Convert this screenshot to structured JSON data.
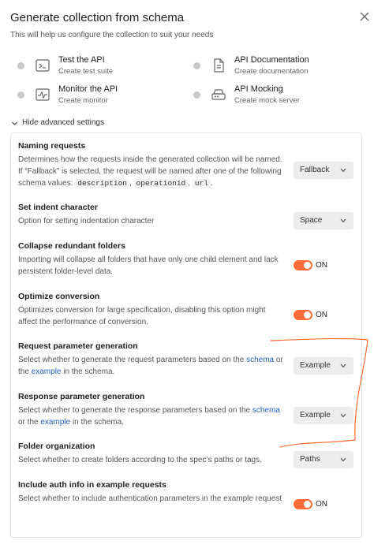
{
  "dialog": {
    "title": "Generate collection from schema",
    "subtitle": "This will help us configure the collection to suit your needs"
  },
  "options": [
    {
      "title": "Test the API",
      "subtitle": "Create test suite",
      "icon": "terminal-icon"
    },
    {
      "title": "API Documentation",
      "subtitle": "Create documentation",
      "icon": "document-icon"
    },
    {
      "title": "Monitor the API",
      "subtitle": "Create monitor",
      "icon": "pulse-icon"
    },
    {
      "title": "API Mocking",
      "subtitle": "Create mock server",
      "icon": "server-icon"
    }
  ],
  "advanced": {
    "label": "Hide advanced settings"
  },
  "settings": {
    "naming": {
      "title": "Naming requests",
      "desc1": "Determines how the requests inside the generated collection will be named. If “Fallback” is selected, the request will be named after one of the following schema values:",
      "code1": "description",
      "code2": "operationid",
      "code3": "url",
      "sep": ",",
      "end": ".",
      "value": "Fallback"
    },
    "indent": {
      "title": "Set indent character",
      "desc": "Option for setting indentation character",
      "value": "Space"
    },
    "collapse": {
      "title": "Collapse redundant folders",
      "desc": "Importing will collapse all folders that have only one child element and lack persistent folder-level data.",
      "value": "ON"
    },
    "optimize": {
      "title": "Optimize conversion",
      "desc": "Optimizes conversion for large specification, disabling this option might affect the performance of conversion.",
      "value": "ON"
    },
    "request_param": {
      "title": "Request parameter generation",
      "desc_a": "Select whether to generate the request parameters based on the",
      "link1": "schema",
      "desc_b": "or the",
      "link2": "example",
      "desc_c": "in the schema.",
      "value": "Example"
    },
    "response_param": {
      "title": "Response parameter generation",
      "desc_a": "Select whether to generate the response parameters based on the",
      "link1": "schema",
      "desc_b": "or the",
      "link2": "example",
      "desc_c": "in the schema.",
      "value": "Example"
    },
    "folder": {
      "title": "Folder organization",
      "desc": "Select whether to create folders according to the spec’s paths or tags.",
      "value": "Paths"
    },
    "auth": {
      "title": "Include auth info in example requests",
      "desc": "Select whether to include authentication parameters in the example request",
      "value": "ON"
    }
  },
  "colors": {
    "accent": "#ff6c37",
    "link": "#1d5fbf",
    "annotation": "#ff6c37"
  }
}
